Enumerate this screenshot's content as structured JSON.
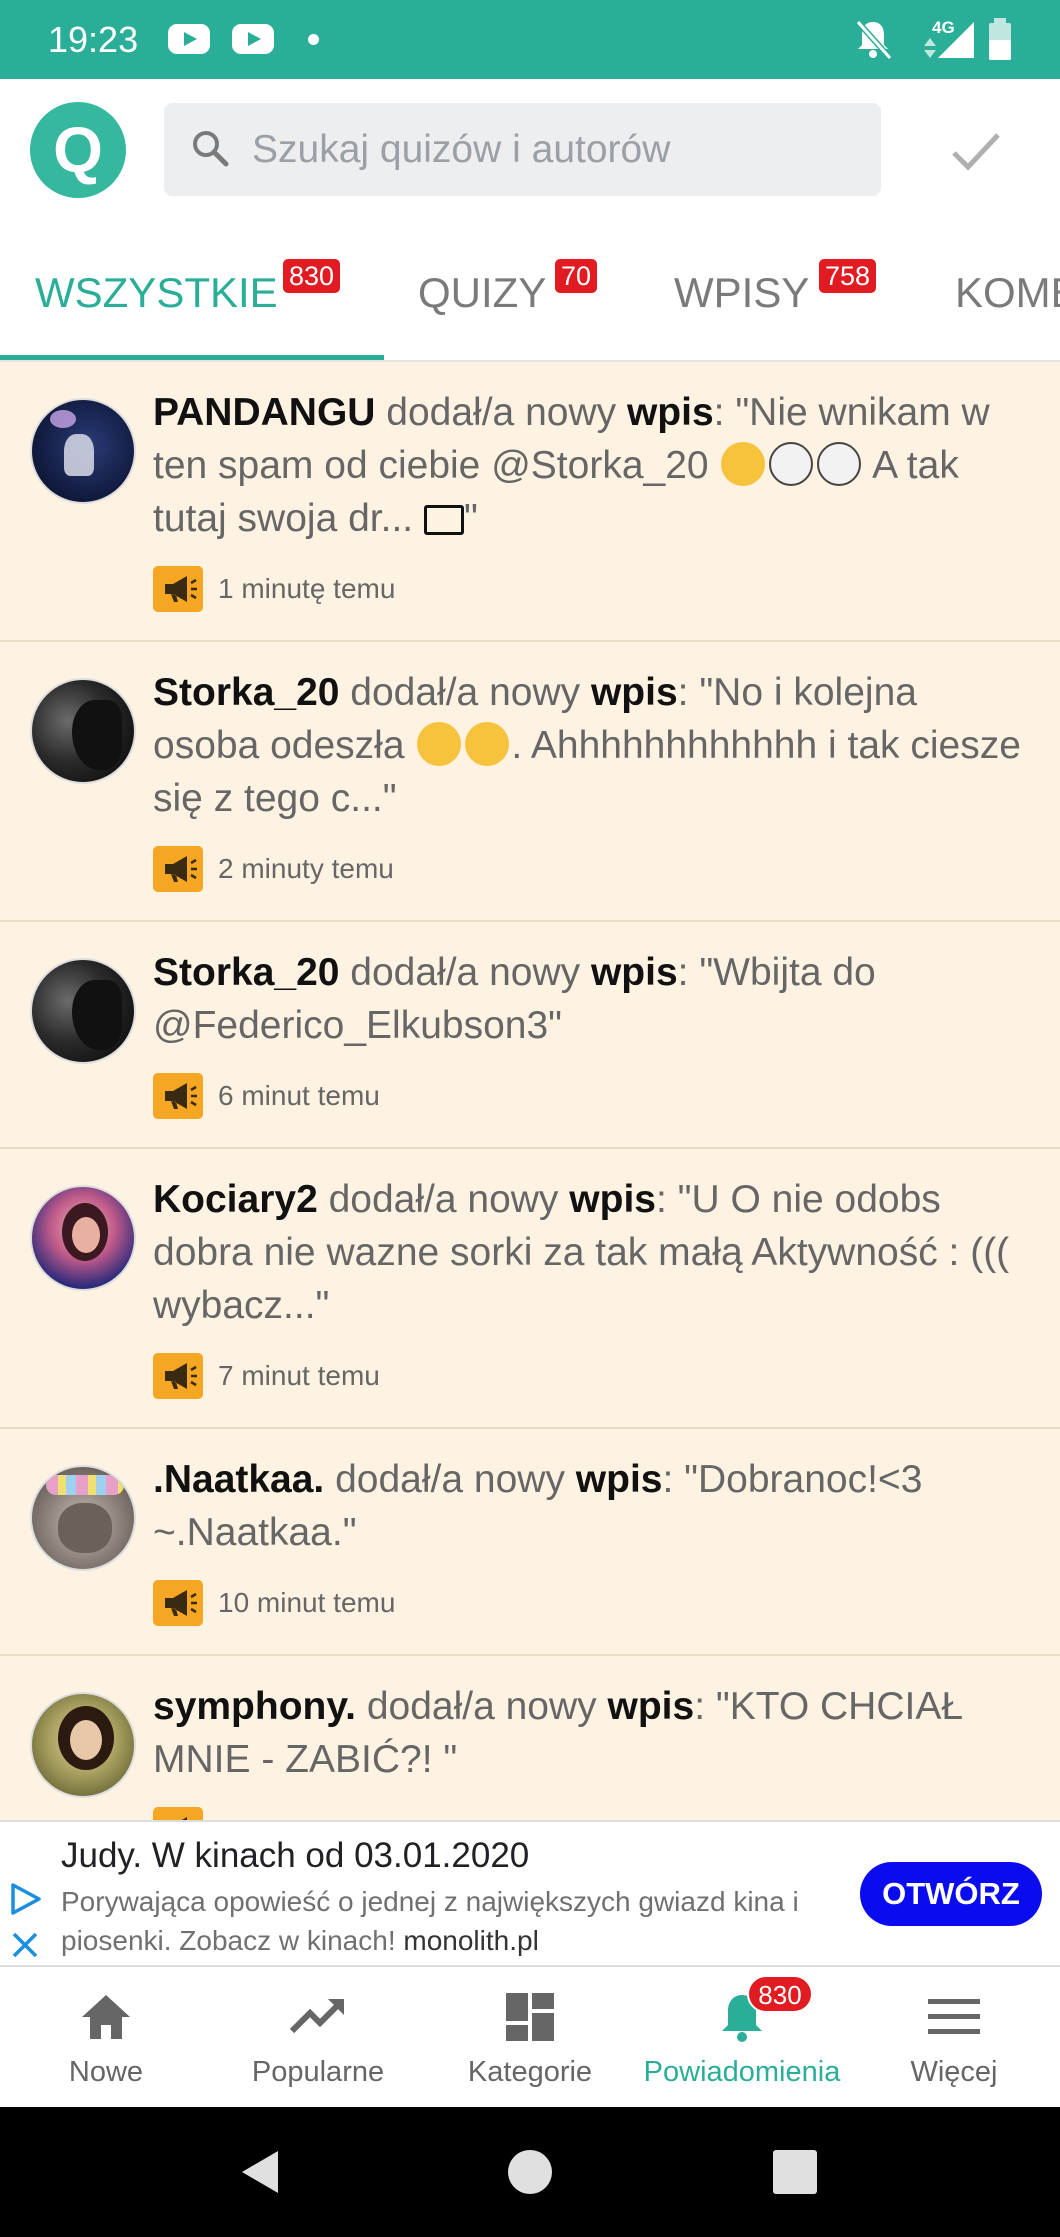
{
  "status_bar": {
    "time": "19:23",
    "network": "4G",
    "color": "#2bae98"
  },
  "header": {
    "logo_letter": "Q",
    "search_placeholder": "Szukaj quizów i autorów"
  },
  "tabs": [
    {
      "label": "WSZYSTKIE",
      "badge": "830",
      "active": true
    },
    {
      "label": "QUIZY",
      "badge": "70",
      "active": false
    },
    {
      "label": "WPISY",
      "badge": "758",
      "active": false
    },
    {
      "label": "KOMENTARZE",
      "badge": "",
      "active": false
    }
  ],
  "feed": [
    {
      "user": "PANDANGU",
      "action": " dodał/a nowy ",
      "kind": "wpis",
      "text_before": ": \"Nie wnikam w ten spam od ciebie @Storka_20 ",
      "text_after": " A tak tutaj swoja dr... ",
      "text_end": "\"",
      "time": "1 minutę temu"
    },
    {
      "user": "Storka_20",
      "action": " dodał/a nowy ",
      "kind": "wpis",
      "text_before": ": \"No i kolejna osoba odeszła ",
      "text_after": ". Ahhhhhhhhhhhh i tak ciesze się z tego c...\"",
      "time": "2 minuty temu"
    },
    {
      "user": "Storka_20",
      "action": " dodał/a nowy ",
      "kind": "wpis",
      "text_before": ": \"Wbijta do @Federico_Elkubson3\"",
      "time": "6 minut temu"
    },
    {
      "user": "Kociary2",
      "action": " dodał/a nowy ",
      "kind": "wpis",
      "text_before": ": \"U O nie odobs dobra nie wazne sorki za tak małą Aktywność : ((( wybacz...\"",
      "time": "7 minut temu"
    },
    {
      "user": ".Naatkaa.",
      "action": " dodał/a nowy ",
      "kind": "wpis",
      "text_before": ": \"Dobranoc!<3 ~.Naatkaa.\"",
      "time": "10 minut temu"
    },
    {
      "user": "symphony.",
      "action": " dodał/a nowy ",
      "kind": "wpis",
      "text_before": ": \"KTO CHCIAŁ MNIE - ZABIĆ?! \"",
      "time": ""
    }
  ],
  "ad": {
    "title": "Judy. W kinach od 03.01.2020",
    "description": "Porywająca opowieść o jednej z największych gwiazd kina i piosenki. Zobacz w kinach! ",
    "url": "monolith.pl",
    "button": "OTWÓRZ"
  },
  "bottom_nav": [
    {
      "label": "Nowe",
      "icon": "home-icon"
    },
    {
      "label": "Popularne",
      "icon": "trending-icon"
    },
    {
      "label": "Kategorie",
      "icon": "dashboard-icon"
    },
    {
      "label": "Powiadomienia",
      "icon": "bell-icon",
      "badge": "830",
      "active": true
    },
    {
      "label": "Więcej",
      "icon": "menu-icon"
    }
  ],
  "colors": {
    "accent": "#2bae98",
    "feed_bg": "#fef3e3",
    "badge_red": "#e01b22",
    "meta_orange": "#f5a623",
    "ad_button": "#0b0bf0"
  }
}
